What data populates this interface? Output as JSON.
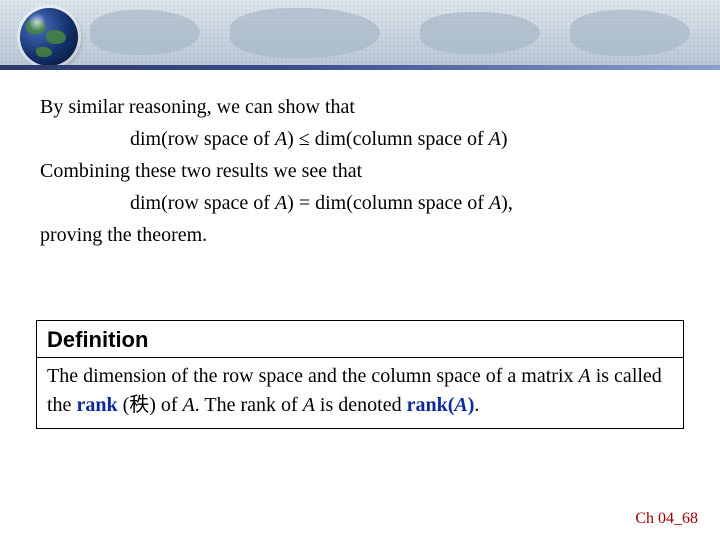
{
  "content": {
    "p1": "By similar reasoning, we can show that",
    "p2_pre": "dim(row space of ",
    "A": "A",
    "p2_mid": ") ≤ dim(column space of ",
    "p2_post": ")",
    "p3": "Combining these two results we see that",
    "p4_pre": "dim(row space of ",
    "p4_mid": ") = dim(column space of ",
    "p4_post": "),",
    "p5": "proving the theorem."
  },
  "definition": {
    "title": "Definition",
    "body_1": "The dimension of the row space and the column space of a matrix ",
    "body_A1": "A",
    "body_2": " is called the ",
    "term_rank": "rank",
    "body_3": " (秩) of ",
    "body_A2": "A",
    "body_4": ". The rank of ",
    "body_A3": "A",
    "body_5": " is denoted ",
    "term_rankA_pre": "rank(",
    "term_rankA_A": "A",
    "term_rankA_post": ")",
    "body_6": "."
  },
  "footer": "Ch 04_68"
}
